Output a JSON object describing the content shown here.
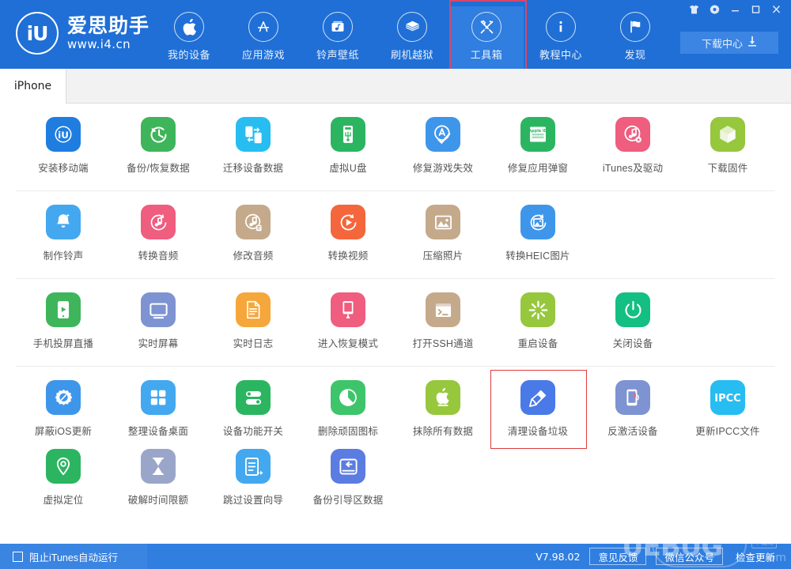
{
  "window": {
    "controls": [
      {
        "name": "skin-icon",
        "glyph": "skin"
      },
      {
        "name": "settings-icon",
        "glyph": "gear"
      },
      {
        "name": "minimize-icon",
        "glyph": "minimize"
      },
      {
        "name": "maximize-icon",
        "glyph": "maximize"
      },
      {
        "name": "close-icon",
        "glyph": "close"
      }
    ]
  },
  "brand": {
    "logo_text": "iU",
    "name": "爱思助手",
    "url": "www.i4.cn"
  },
  "nav": {
    "items": [
      {
        "label": "我的设备",
        "icon": "apple-icon",
        "active": false,
        "highlight": false
      },
      {
        "label": "应用游戏",
        "icon": "appstore-icon",
        "active": false,
        "highlight": false
      },
      {
        "label": "铃声壁纸",
        "icon": "ringtone-icon",
        "active": false,
        "highlight": false
      },
      {
        "label": "刷机越狱",
        "icon": "flash-icon",
        "active": false,
        "highlight": false
      },
      {
        "label": "工具箱",
        "icon": "toolbox-icon",
        "active": true,
        "highlight": true
      },
      {
        "label": "教程中心",
        "icon": "info-icon",
        "active": false,
        "highlight": false
      },
      {
        "label": "发现",
        "icon": "flag-icon",
        "active": false,
        "highlight": false
      }
    ],
    "download_center": {
      "label": "下载中心",
      "icon": "download-icon"
    }
  },
  "tabs": [
    {
      "label": "iPhone",
      "active": true
    }
  ],
  "colors": {
    "header_blue": "#1f6fd6",
    "nav_active": "#2f7ee0",
    "nav_highlight_border": "#d5486a",
    "tile_selected_border": "#e03b3b",
    "footer_blue": "#2f7ee0"
  },
  "tool_sections": [
    {
      "tiles": [
        {
          "label": "安装移动端",
          "icon": "i4-app-icon",
          "color": "#1f7de0",
          "selected": false
        },
        {
          "label": "备份/恢复数据",
          "icon": "backup-restore-icon",
          "color": "#3eb55a",
          "selected": false
        },
        {
          "label": "迁移设备数据",
          "icon": "migrate-data-icon",
          "color": "#27bdf0",
          "selected": false
        },
        {
          "label": "虚拟U盘",
          "icon": "usb-drive-icon",
          "color": "#2cb561",
          "selected": false
        },
        {
          "label": "修复游戏失效",
          "icon": "fix-game-icon",
          "color": "#3e96ea",
          "selected": false
        },
        {
          "label": "修复应用弹窗",
          "icon": "apple-id-icon",
          "color": "#2cb561",
          "selected": false
        },
        {
          "label": "iTunes及驱动",
          "icon": "itunes-icon",
          "color": "#ef5d7f",
          "selected": false
        },
        {
          "label": "下载固件",
          "icon": "firmware-icon",
          "color": "#96c73d",
          "selected": false
        }
      ]
    },
    {
      "tiles": [
        {
          "label": "制作铃声",
          "icon": "make-ringtone-icon",
          "color": "#43a8ef",
          "selected": false
        },
        {
          "label": "转换音频",
          "icon": "convert-audio-icon",
          "color": "#ef5d7f",
          "selected": false
        },
        {
          "label": "修改音频",
          "icon": "edit-audio-icon",
          "color": "#c4a98b",
          "selected": false
        },
        {
          "label": "转换视频",
          "icon": "convert-video-icon",
          "color": "#f4663b",
          "selected": false
        },
        {
          "label": "压缩照片",
          "icon": "compress-photo-icon",
          "color": "#c4a98b",
          "selected": false
        },
        {
          "label": "转换HEIC图片",
          "icon": "heic-convert-icon",
          "color": "#3e96ea",
          "selected": false
        }
      ]
    },
    {
      "tiles": [
        {
          "label": "手机投屏直播",
          "icon": "screen-cast-icon",
          "color": "#3eb55a",
          "selected": false
        },
        {
          "label": "实时屏幕",
          "icon": "live-screen-icon",
          "color": "#7e93d1",
          "selected": false
        },
        {
          "label": "实时日志",
          "icon": "live-log-icon",
          "color": "#f5a73b",
          "selected": false
        },
        {
          "label": "进入恢复模式",
          "icon": "recovery-mode-icon",
          "color": "#ef5d7f",
          "selected": false
        },
        {
          "label": "打开SSH通道",
          "icon": "ssh-icon",
          "color": "#c4a98b",
          "selected": false
        },
        {
          "label": "重启设备",
          "icon": "reboot-icon",
          "color": "#96c73d",
          "selected": false
        },
        {
          "label": "关闭设备",
          "icon": "poweroff-icon",
          "color": "#13bf82",
          "selected": false
        }
      ]
    },
    {
      "tiles": [
        {
          "label": "屏蔽iOS更新",
          "icon": "block-update-icon",
          "color": "#3e96ea",
          "selected": false
        },
        {
          "label": "整理设备桌面",
          "icon": "organize-home-icon",
          "color": "#43a8ef",
          "selected": false
        },
        {
          "label": "设备功能开关",
          "icon": "feature-toggle-icon",
          "color": "#2cb561",
          "selected": false
        },
        {
          "label": "删除顽固图标",
          "icon": "delete-icon-icon",
          "color": "#3ec46b",
          "selected": false
        },
        {
          "label": "抹除所有数据",
          "icon": "erase-all-icon",
          "color": "#96c73d",
          "selected": false
        },
        {
          "label": "清理设备垃圾",
          "icon": "clean-junk-icon",
          "color": "#4a79e8",
          "selected": true
        },
        {
          "label": "反激活设备",
          "icon": "deactivate-icon",
          "color": "#7e93d1",
          "selected": false
        },
        {
          "label": "更新IPCC文件",
          "icon": "ipcc-icon",
          "color": "#27bdf0",
          "selected": false
        },
        {
          "label": "虚拟定位",
          "icon": "fake-location-icon",
          "color": "#2cb561",
          "selected": false
        },
        {
          "label": "破解时间限额",
          "icon": "time-limit-icon",
          "color": "#9aa6c9",
          "selected": false
        },
        {
          "label": "跳过设置向导",
          "icon": "skip-setup-icon",
          "color": "#43a8ef",
          "selected": false
        },
        {
          "label": "备份引导区数据",
          "icon": "backup-boot-icon",
          "color": "#5b7ce0",
          "selected": false
        }
      ]
    }
  ],
  "footer": {
    "block_itunes_label": "阻止iTunes自动运行",
    "block_itunes_checked": false,
    "version": "V7.98.02",
    "feedback_label": "意见反馈",
    "wechat_label": "微信公众号",
    "update_label": "检查更新"
  },
  "watermark": {
    "text": "UEBUG",
    "sub": "om",
    "tag": "下载站"
  }
}
